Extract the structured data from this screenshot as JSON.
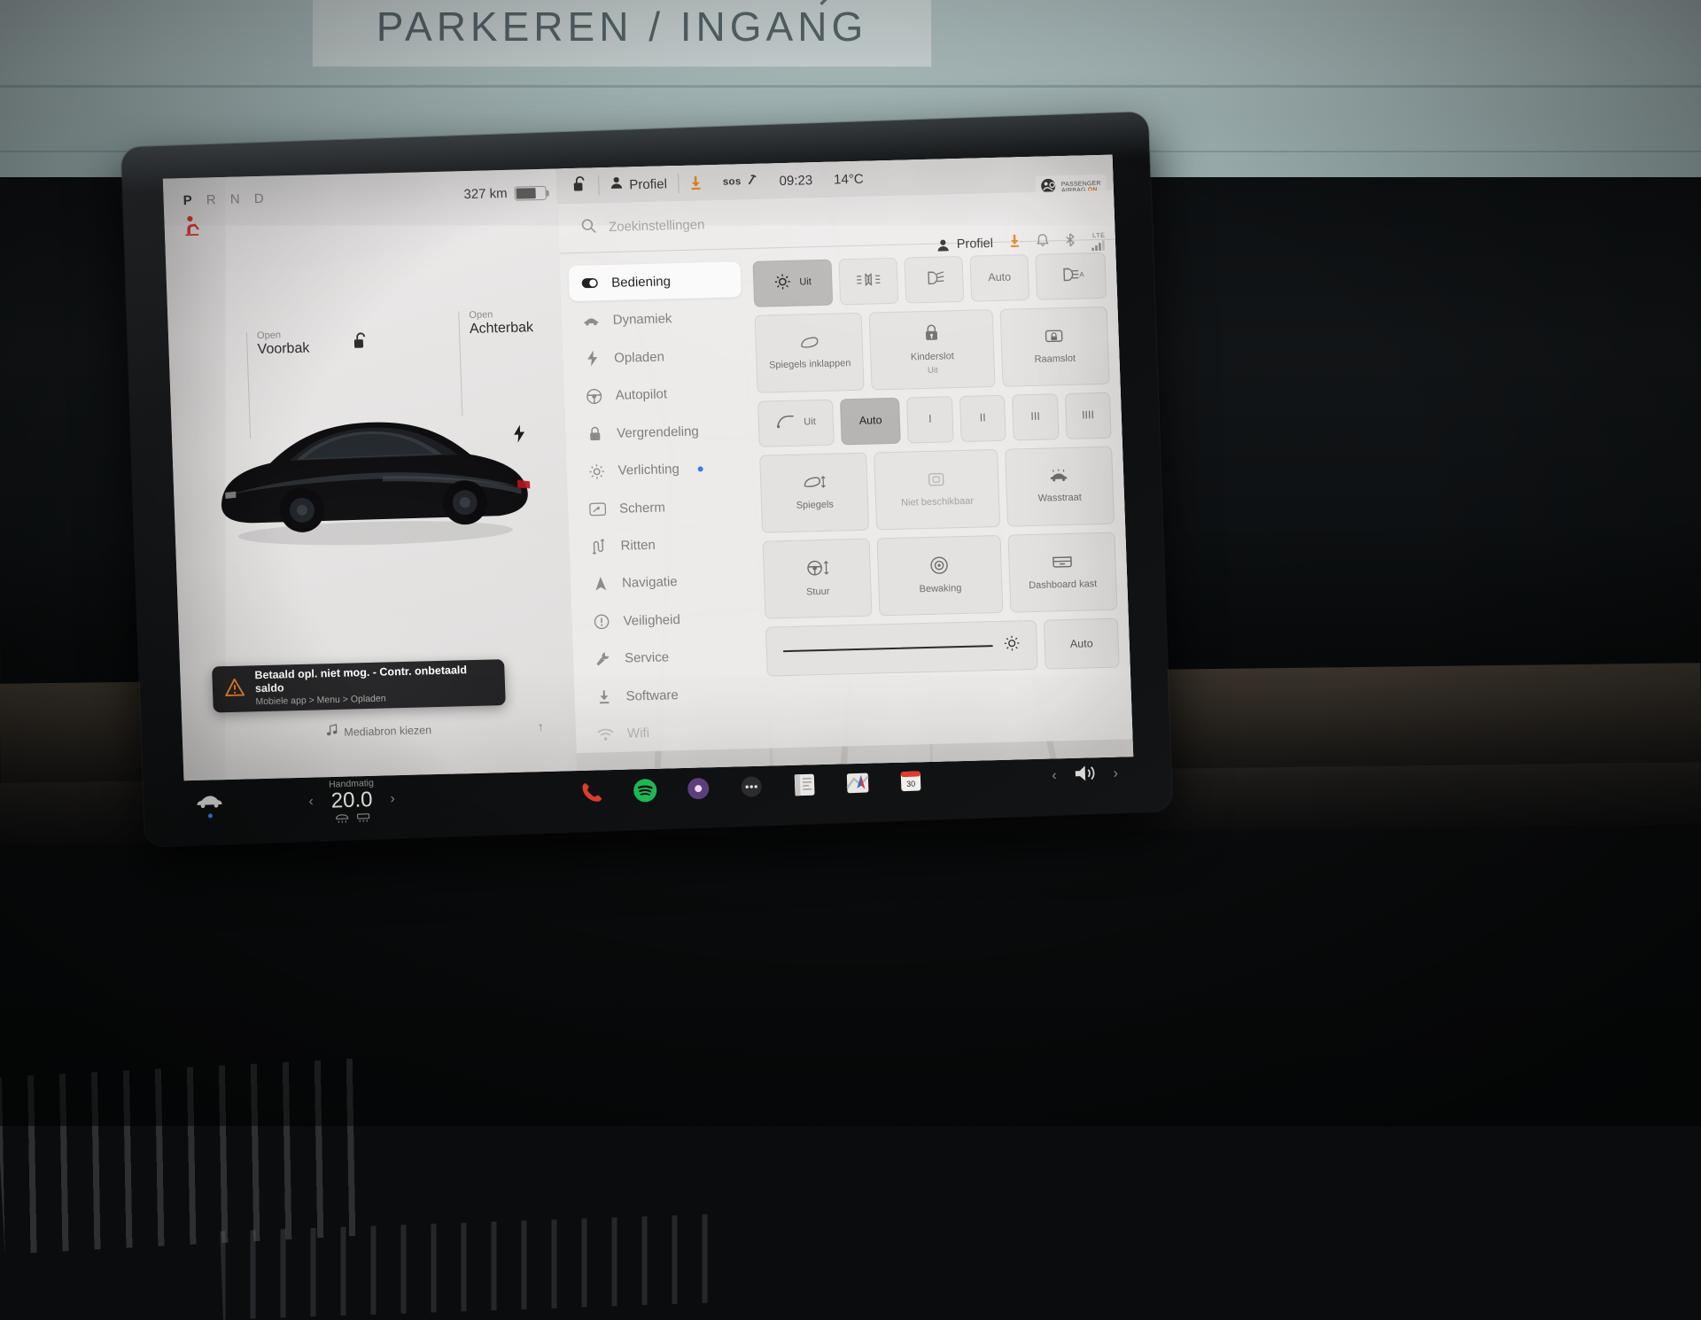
{
  "scene": {
    "sign_text": "PARKEREN / INGANG"
  },
  "car_status": {
    "gear_indicator": "P R N D",
    "gear_active": "P",
    "range": "327 km",
    "battery_percent": 66,
    "seatbelt_warning_icon": "seatbelt-warning-icon"
  },
  "left_pane": {
    "frunk": {
      "action": "Open",
      "label": "Voorbak"
    },
    "trunk": {
      "action": "Open",
      "label": "Achterbak"
    },
    "unlock_icon": "unlock-icon",
    "charge_port_icon": "charge-bolt-icon",
    "toast": {
      "title": "Betaald opl. niet mog. - Contr. onbetaald saldo",
      "subtitle": "Mobiele app > Menu > Opladen",
      "icon": "warning-triangle-icon"
    },
    "media": {
      "label": "Mediabron kiezen",
      "icon": "music-note-icon",
      "expand_icon": "chevron-up-icon"
    }
  },
  "status_bar": {
    "range": "327 km",
    "lock_icon": "unlock-icon",
    "profile_icon": "person-icon",
    "profile_label": "Profiel",
    "download_icon": "software-update-download-icon",
    "sos_label": "sos",
    "time": "09:23",
    "temperature": "14°C"
  },
  "settings": {
    "search": {
      "placeholder": "Zoekinstellingen",
      "icon": "search-icon"
    },
    "account": {
      "profile_icon": "person-icon",
      "profile_label": "Profiel",
      "download_icon": "download-icon",
      "bell_icon": "bell-icon",
      "bluetooth_icon": "bluetooth-icon",
      "lte_label": "LTE",
      "signal_icon": "signal-bars-icon"
    },
    "nav_items": [
      {
        "label": "Bediening",
        "icon": "toggle-icon",
        "active": true,
        "dot": false
      },
      {
        "label": "Dynamiek",
        "icon": "car-icon",
        "active": false,
        "dot": false
      },
      {
        "label": "Opladen",
        "icon": "bolt-icon",
        "active": false,
        "dot": false
      },
      {
        "label": "Autopilot",
        "icon": "steering-wheel-icon",
        "active": false,
        "dot": false
      },
      {
        "label": "Vergrendeling",
        "icon": "lock-icon",
        "active": false,
        "dot": false
      },
      {
        "label": "Verlichting",
        "icon": "sun-icon",
        "active": false,
        "dot": true
      },
      {
        "label": "Scherm",
        "icon": "display-icon",
        "active": false,
        "dot": false
      },
      {
        "label": "Ritten",
        "icon": "trips-icon",
        "active": false,
        "dot": false
      },
      {
        "label": "Navigatie",
        "icon": "navigation-arrow-icon",
        "active": false,
        "dot": false
      },
      {
        "label": "Veiligheid",
        "icon": "shield-alert-icon",
        "active": false,
        "dot": false
      },
      {
        "label": "Service",
        "icon": "wrench-icon",
        "active": false,
        "dot": false
      },
      {
        "label": "Software",
        "icon": "download-icon",
        "active": false,
        "dot": false
      },
      {
        "label": "Wifi",
        "icon": "wifi-icon",
        "active": false,
        "dot": false
      }
    ],
    "lights_row": [
      {
        "label": "Uit",
        "icon": "lamp-icon",
        "selected": true
      },
      {
        "label": "",
        "icon": "parking-lights-icon",
        "selected": false
      },
      {
        "label": "",
        "icon": "low-beam-icon",
        "selected": false
      },
      {
        "label": "Auto",
        "icon": "",
        "selected": false
      },
      {
        "label": "",
        "icon": "auto-high-beam-icon",
        "selected": false
      }
    ],
    "row2": [
      {
        "label": "Spiegels inklappen",
        "icon": "mirror-fold-icon",
        "sub": "",
        "disabled": false
      },
      {
        "label": "Kinderslot",
        "icon": "child-lock-icon",
        "sub": "Uit",
        "disabled": false
      },
      {
        "label": "Raamslot",
        "icon": "window-lock-icon",
        "sub": "",
        "disabled": false
      }
    ],
    "wipers_row": [
      {
        "label": "Uit",
        "icon": "wiper-icon",
        "selected": false
      },
      {
        "label": "Auto",
        "icon": "",
        "selected": true
      },
      {
        "label": "I",
        "icon": "",
        "selected": false
      },
      {
        "label": "II",
        "icon": "",
        "selected": false
      },
      {
        "label": "III",
        "icon": "",
        "selected": false
      },
      {
        "label": "IIII",
        "icon": "",
        "selected": false
      }
    ],
    "row4": [
      {
        "label": "Spiegels",
        "icon": "mirror-adjust-icon",
        "disabled": false
      },
      {
        "label": "Niet beschikbaar",
        "icon": "unavailable-icon",
        "disabled": true
      },
      {
        "label": "Wasstraat",
        "icon": "car-wash-icon",
        "disabled": false
      }
    ],
    "row5": [
      {
        "label": "Stuur",
        "icon": "steering-adjust-icon",
        "disabled": false
      },
      {
        "label": "Bewaking",
        "icon": "sentry-camera-icon",
        "disabled": false
      },
      {
        "label": "Dashboard kast",
        "icon": "glovebox-icon",
        "disabled": false
      }
    ],
    "brightness": {
      "slider_icon": "brightness-icon",
      "slider_value": 100,
      "auto_label": "Auto"
    }
  },
  "airbag_badge": {
    "icon": "passenger-airbag-icon",
    "line1": "PASSENGER",
    "line2": "AIRBAG",
    "state": "ON"
  },
  "bottom_bar": {
    "car_icon": "car-icon",
    "climate": {
      "mode": "Handmatig",
      "temperature": "20.0",
      "left_chevron": "chevron-left-icon",
      "right_chevron": "chevron-right-icon",
      "defrost_front_icon": "front-defrost-icon",
      "defrost_rear_icon": "rear-defrost-icon"
    },
    "apps": [
      {
        "name": "phone-icon"
      },
      {
        "name": "spotify-icon"
      },
      {
        "name": "media-icon"
      },
      {
        "name": "dots-menu-icon"
      },
      {
        "name": "browser-icon"
      },
      {
        "name": "navigation-icon"
      },
      {
        "name": "calendar-icon",
        "badge": "30"
      }
    ],
    "volume": {
      "prev_icon": "chevron-left-icon",
      "speaker_icon": "volume-icon",
      "next_icon": "chevron-right-icon"
    }
  },
  "colors": {
    "accent_orange": "#d9661f",
    "accent_blue": "#2f7ff0",
    "warning_red": "#e82c25",
    "spotify_green": "#1db954",
    "screen_bg": "#e8e6e4"
  }
}
